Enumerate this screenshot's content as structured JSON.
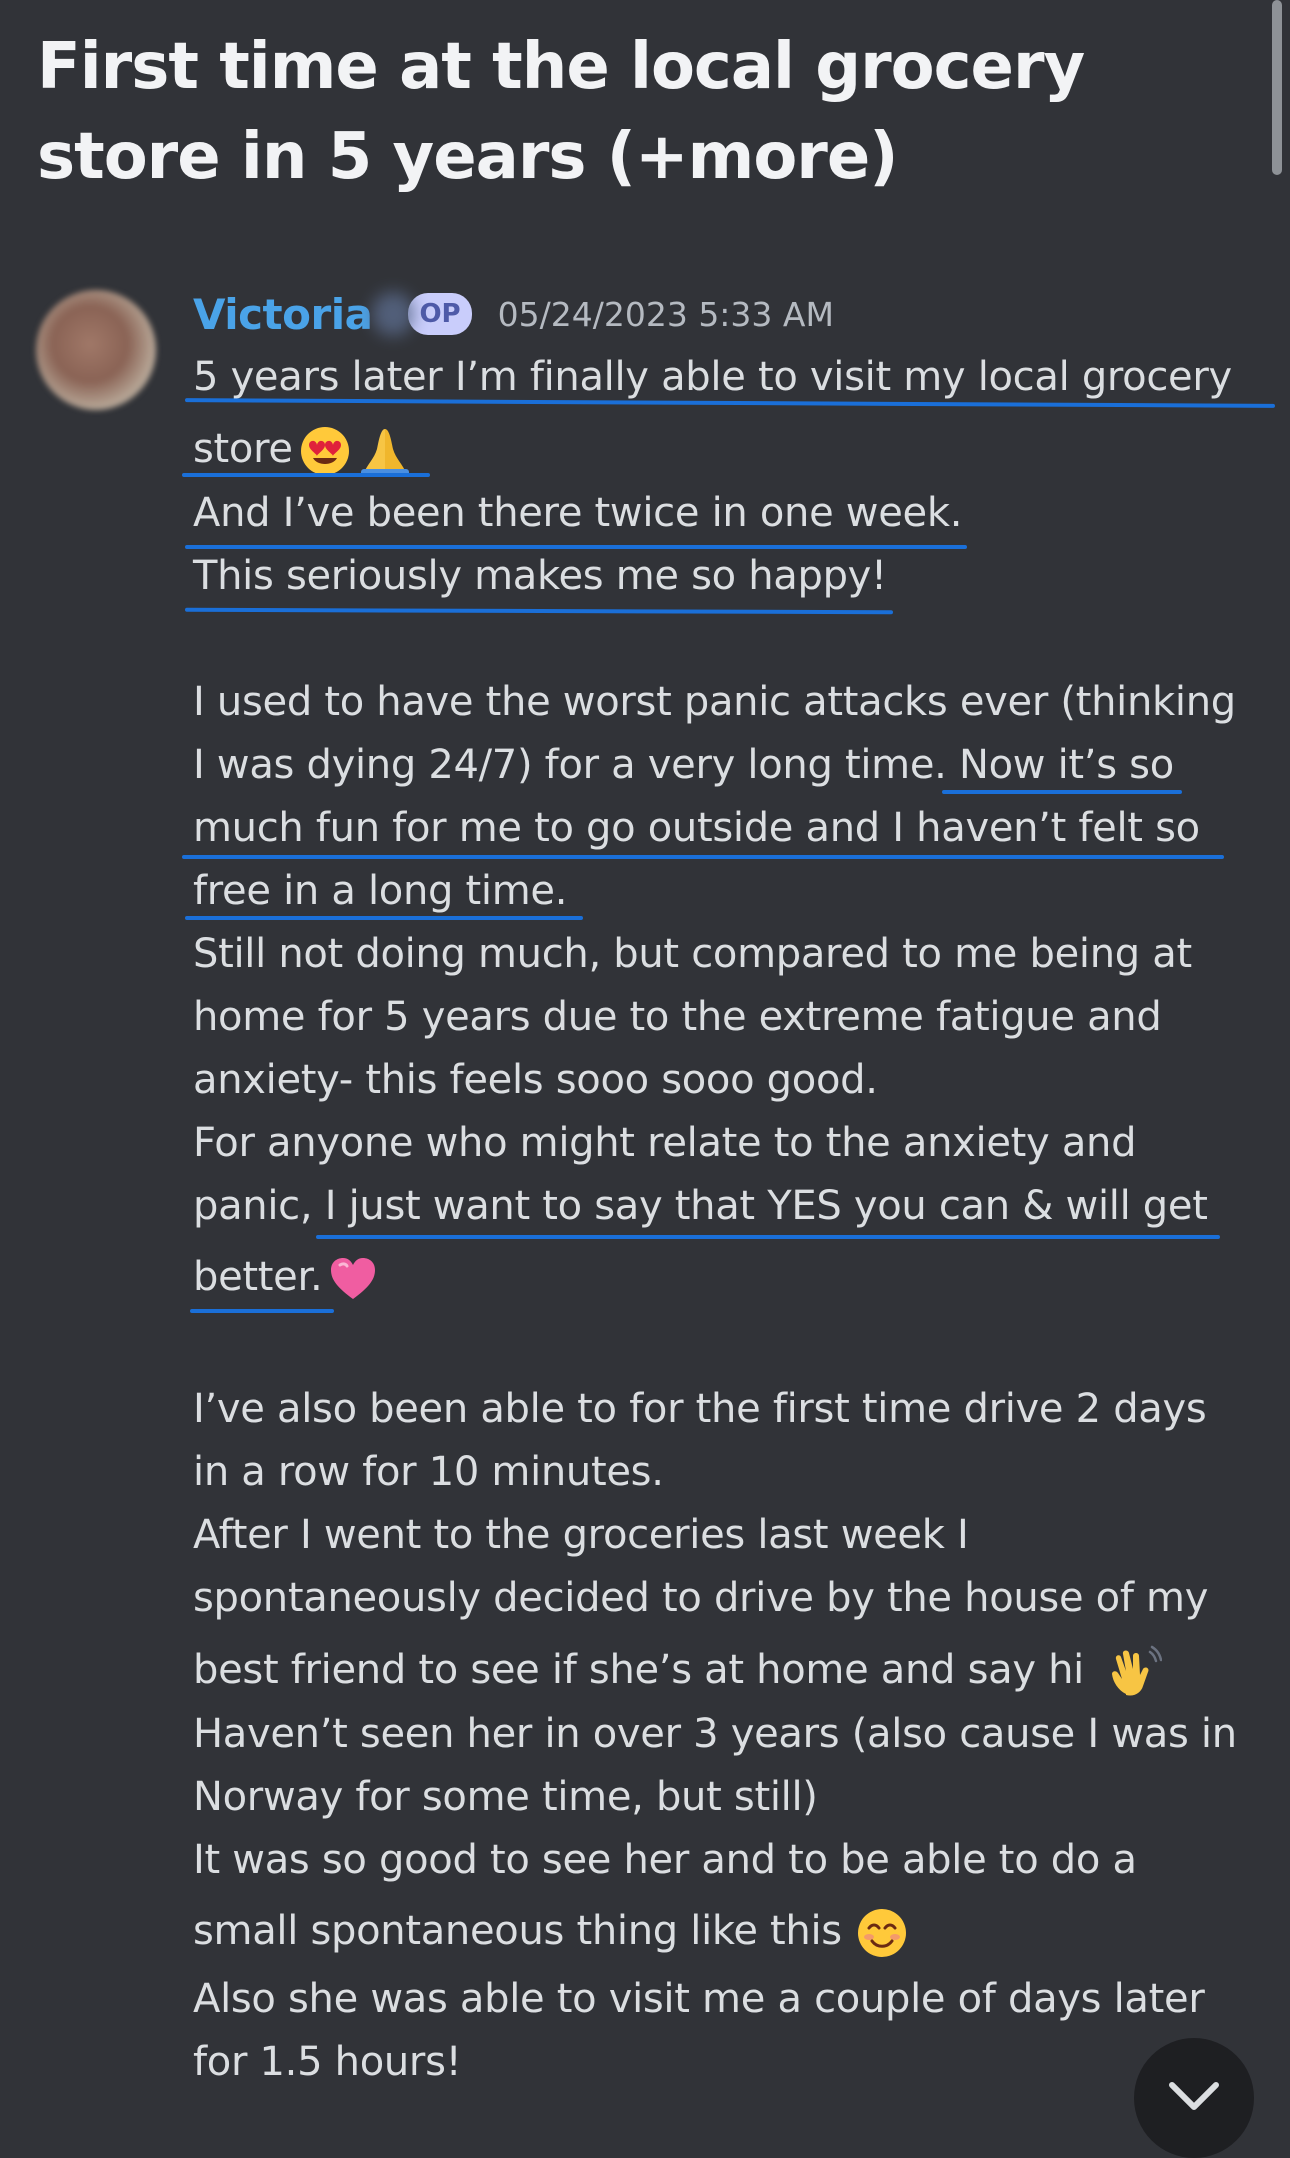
{
  "post": {
    "title": "First time at the local grocery store in 5 years (+more)",
    "author": "Victoria",
    "badge": "OP",
    "timestamp": "05/24/2023 5:33 AM"
  },
  "message": {
    "lines": [
      "5 years later I’m finally able to visit my local grocery",
      "store",
      "And I’ve been there twice in one week.",
      "This seriously makes me so happy!",
      "I used to have the worst panic attacks ever (thinking",
      "I was dying 24/7) for a very long time. Now it’s so",
      "much fun for me to go outside and I haven’t felt so",
      "free in a long time.",
      "Still not doing much, but compared to me being at",
      "home for 5 years due to the extreme fatigue and",
      "anxiety- this feels sooo sooo good.",
      "For anyone who might relate to the anxiety and",
      "panic, I just want to say that YES you can & will get",
      "better.",
      "I’ve also been able to for the first time drive 2 days",
      "in a row for 10 minutes.",
      "After I went to the groceries last week I",
      "spontaneously decided to drive by the house of my",
      "best friend to see if she’s at home and say hi",
      "Haven’t seen her in over 3 years (also cause I was in",
      "Norway for some time, but still)",
      "It was so good to see her and to be able to do a",
      "small spontaneous thing like this",
      "Also she was able to visit me a couple of days later",
      "for 1.5 hours!"
    ],
    "emojis": [
      "heart-eyes-emoji",
      "folded-hands-emoji",
      "pink-heart-emoji",
      "waving-hand-emoji",
      "smiling-face-emoji"
    ]
  },
  "colors": {
    "background": "#313338",
    "author": "#4aa3e8",
    "underline_annotation": "#1a6fd8",
    "text": "#dbdee1"
  }
}
